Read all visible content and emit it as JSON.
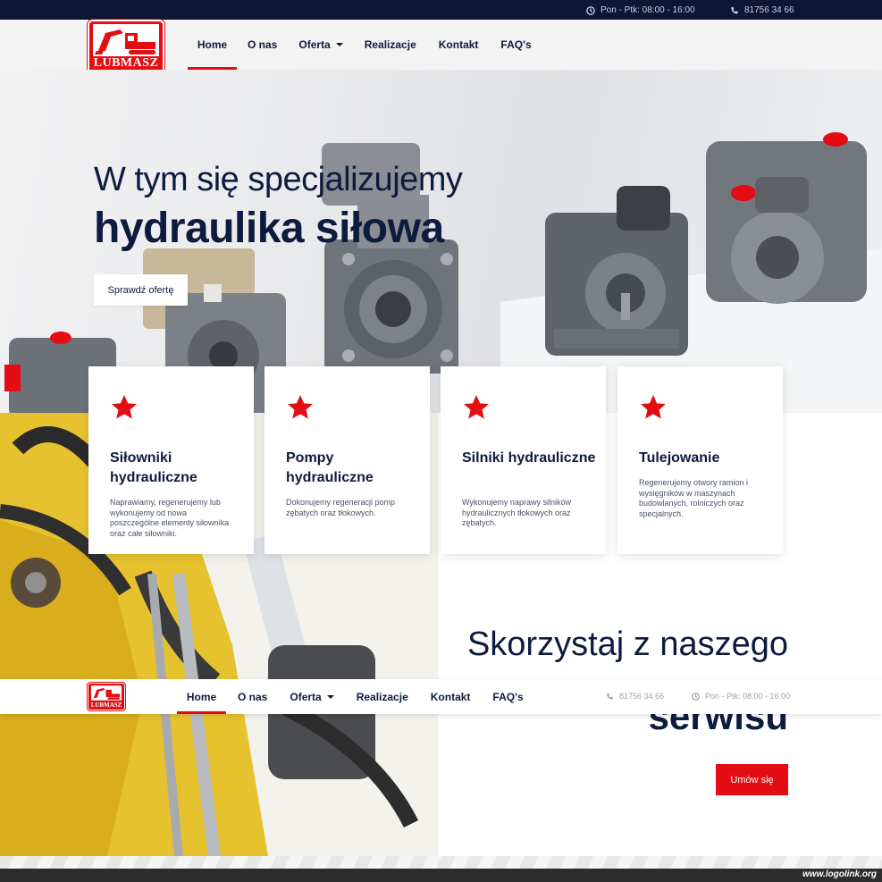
{
  "topbar": {
    "hours": "Pon - Ptk: 08:00 - 16:00",
    "phone": "81756 34 66"
  },
  "brand": {
    "logo_text": "LUBMASZ",
    "accent": "#e30d13",
    "navy": "#0d1b3e"
  },
  "nav": {
    "items": [
      "Home",
      "O nas",
      "Oferta",
      "Realizacje",
      "Kontakt",
      "FAQ's"
    ],
    "active": "Home"
  },
  "hero": {
    "title_light": "W tym się specjalizujemy",
    "title_bold": "hydraulika siłowa",
    "button": "Sprawdź ofertę"
  },
  "cards": [
    {
      "icon": "star-icon",
      "title": "Siłowniki hydrauliczne",
      "text": "Naprawiamy, regenerujemy lub wykonujemy od nowa poszczególne elementy siłownika oraz całe siłowniki."
    },
    {
      "icon": "star-icon",
      "title": "Pompy hydrauliczne",
      "text": "Dokonujemy regeneracji pomp zębatych oraz tłokowych."
    },
    {
      "icon": "star-icon",
      "title": "Silniki hydrauliczne",
      "text": "Wykonujemy naprawy silników hydraulicznych tłokowych oraz zębatych."
    },
    {
      "icon": "star-icon",
      "title": "Tulejowanie",
      "text": "Regenerujemy otwory ramion i wysięgników w maszynach budowlanych, rolniczych oraz specjalnych."
    }
  ],
  "service": {
    "title_line1": "Skorzystaj z naszego",
    "title_line2": "serwisu",
    "button": "Umów się"
  },
  "sticky": {
    "phone": "81756 34 66",
    "hours": "Pon - Ptk: 08:00 - 16:00"
  },
  "watermark": "www.logolink.org"
}
